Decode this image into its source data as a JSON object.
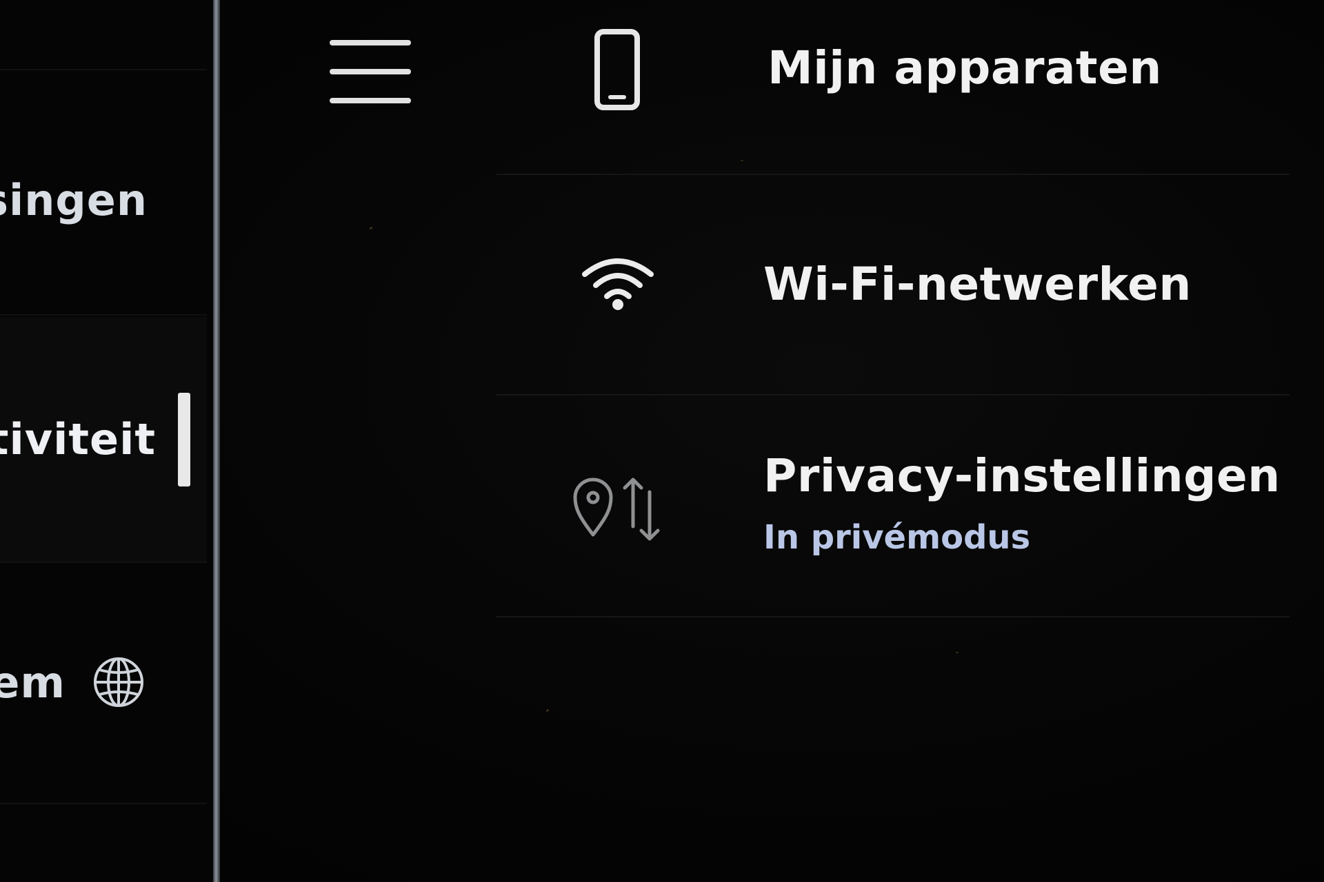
{
  "sidebar": {
    "items": [
      {
        "label": "singen",
        "active": false
      },
      {
        "label": "ctiviteit",
        "active": true
      },
      {
        "label": "em",
        "icon": "globe-icon",
        "active": false
      }
    ]
  },
  "header": {
    "menu_icon": "hamburger-menu-icon"
  },
  "settings": {
    "rows": [
      {
        "title": "Mijn apparaten",
        "icon": "smartphone-icon"
      },
      {
        "title": "Wi-Fi-netwerken",
        "icon": "wifi-icon"
      },
      {
        "title": "Privacy-instellingen",
        "subtitle": "In privémodus",
        "icon": "location-data-transfer-icon"
      }
    ]
  },
  "colors": {
    "background": "#040404",
    "text": "#f1f1f1",
    "subtitle": "#b9c6e6",
    "divider": "#8d949a"
  }
}
